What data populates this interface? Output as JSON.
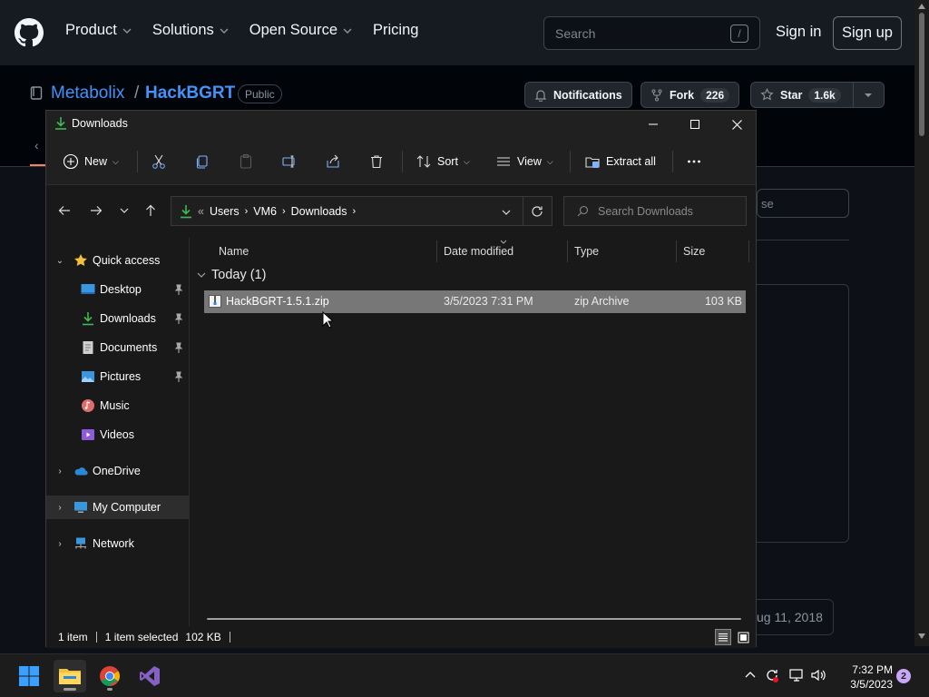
{
  "github": {
    "nav": [
      "Product",
      "Solutions",
      "Open Source",
      "Pricing"
    ],
    "search_placeholder": "Search",
    "search_shortcut": "/",
    "sign_in": "Sign in",
    "sign_up": "Sign up",
    "repo_owner": "Metabolix",
    "repo_separator": "/",
    "repo_name": "HackBGRT",
    "visibility": "Public",
    "notifications_label": "Notifications",
    "fork_label": "Fork",
    "fork_count": "226",
    "star_label": "Star",
    "star_count": "1.6k",
    "filter_partial": "se",
    "date_partial": "ug 11, 2018"
  },
  "explorer": {
    "title": "Downloads",
    "toolbar": {
      "new_label": "New",
      "sort_label": "Sort",
      "view_label": "View",
      "extract_label": "Extract all"
    },
    "address": {
      "overflow": "«",
      "segments": [
        "Users",
        "VM6",
        "Downloads"
      ]
    },
    "search_placeholder": "Search Downloads",
    "sidebar": {
      "quick_access": "Quick access",
      "pinned": [
        {
          "label": "Desktop",
          "icon": "desktop-icon"
        },
        {
          "label": "Downloads",
          "icon": "downloads-icon"
        },
        {
          "label": "Documents",
          "icon": "documents-icon"
        },
        {
          "label": "Pictures",
          "icon": "pictures-icon"
        }
      ],
      "unpinned": [
        {
          "label": "Music",
          "icon": "music-icon"
        },
        {
          "label": "Videos",
          "icon": "videos-icon"
        }
      ],
      "onedrive": "OneDrive",
      "my_computer": "My Computer",
      "network": "Network"
    },
    "columns": [
      "Name",
      "Date modified",
      "Type",
      "Size"
    ],
    "group": "Today (1)",
    "files": [
      {
        "name": "HackBGRT-1.5.1.zip",
        "date": "3/5/2023 7:31 PM",
        "type": "zip Archive",
        "size": "103 KB"
      }
    ],
    "status": {
      "count": "1 item",
      "selected": "1 item selected",
      "selected_size": "102 KB"
    }
  },
  "taskbar": {
    "time": "7:32 PM",
    "date": "3/5/2023",
    "notifications": "2"
  },
  "colors": {
    "accent_link": "#4493f8",
    "selection": "#777777",
    "folder_green": "#3fb950"
  }
}
